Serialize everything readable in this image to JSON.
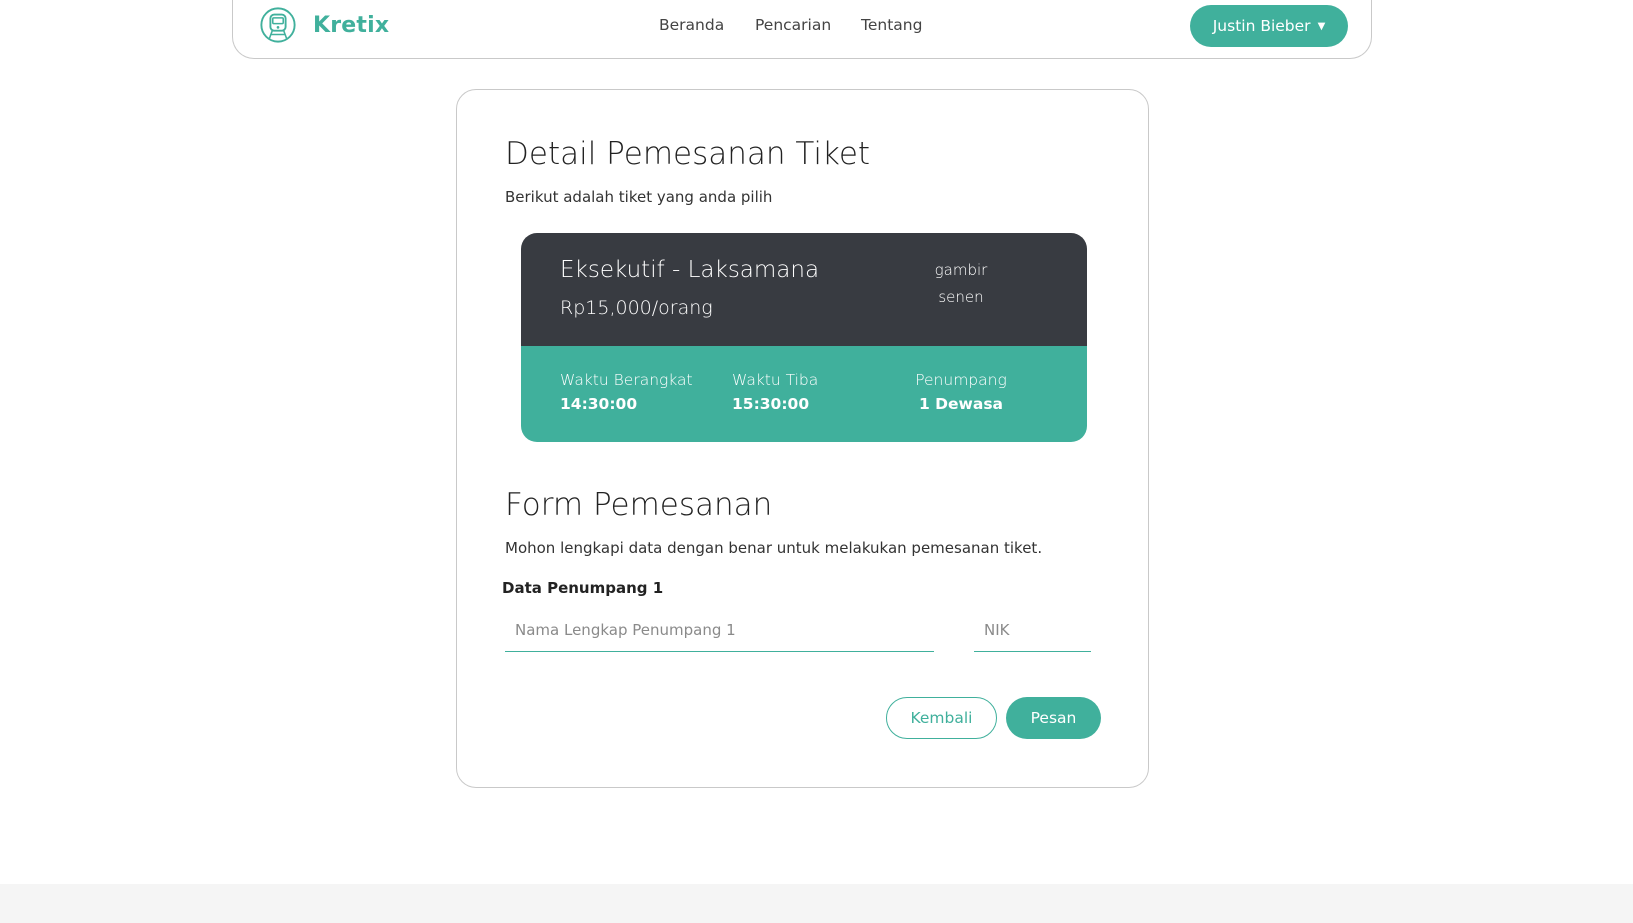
{
  "navbar": {
    "brand": "Kretix",
    "links": [
      "Beranda",
      "Pencarian",
      "Tentang"
    ],
    "user_name": "Justin Bieber"
  },
  "detail": {
    "title": "Detail Pemesanan Tiket",
    "subtitle": "Berikut adalah tiket yang anda pilih"
  },
  "ticket": {
    "train": "Eksekutif - Laksamana",
    "price": "Rp15,000/orang",
    "origin": "gambir",
    "destination": "senen",
    "departure_label": "Waktu Berangkat",
    "departure_time": "14:30:00",
    "arrival_label": "Waktu Tiba",
    "arrival_time": "15:30:00",
    "passenger_label": "Penumpang",
    "passenger_value": "1 Dewasa"
  },
  "form": {
    "title": "Form Pemesanan",
    "subtitle": "Mohon lengkapi data dengan benar untuk melakukan pemesanan tiket.",
    "passenger_section": "Data Penumpang 1",
    "name_placeholder": "Nama Lengkap Penumpang 1",
    "name_value": "",
    "nik_placeholder": "NIK",
    "nik_value": "",
    "back_label": "Kembali",
    "order_label": "Pesan"
  },
  "colors": {
    "accent": "#40b09c",
    "ticket_dark": "#383b41",
    "footer": "#f5f5f5"
  },
  "icons": {
    "brand": "train-icon"
  }
}
